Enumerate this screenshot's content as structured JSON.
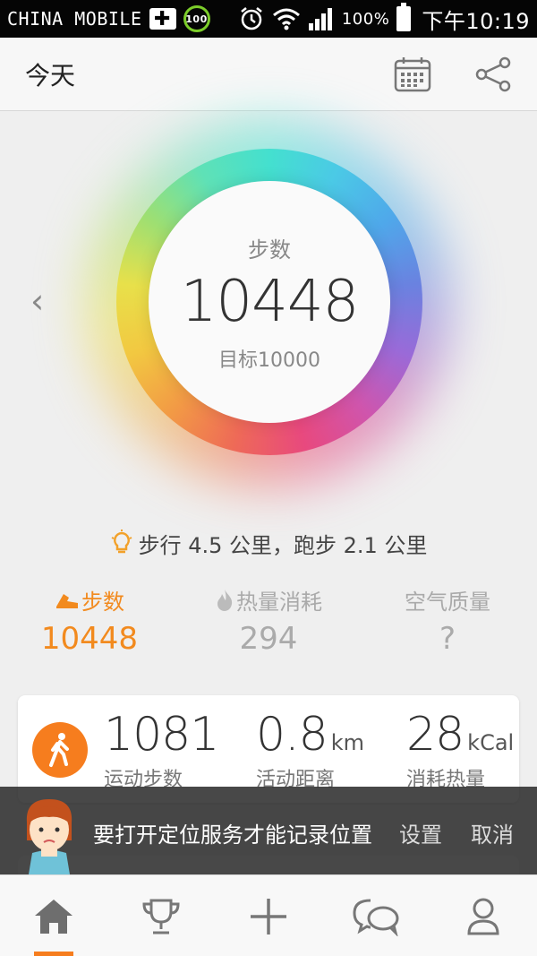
{
  "status_bar": {
    "carrier": "CHINA MOBILE",
    "badge": "100",
    "battery": "100%",
    "time": "下午10:19"
  },
  "header": {
    "title": "今天",
    "icons": [
      "calendar-icon",
      "share-icon"
    ]
  },
  "ring": {
    "label": "步数",
    "steps": "10448",
    "goal": "目标10000",
    "progress": 1.0
  },
  "tip": {
    "text": "步行 4.5 公里，跑步 2.1 公里"
  },
  "stat_tabs": [
    {
      "label": "步数",
      "value": "10448",
      "icon": "shoe-icon",
      "active": true
    },
    {
      "label": "热量消耗",
      "value": "294",
      "icon": "flame-icon",
      "active": false
    },
    {
      "label": "空气质量",
      "value": "?",
      "icon": "",
      "active": false
    }
  ],
  "activity_card": {
    "steps": {
      "value": "1081",
      "unit": "",
      "caption": "运动步数"
    },
    "distance": {
      "value": "0.8",
      "unit": "km",
      "caption": "活动距离"
    },
    "calories": {
      "value": "28",
      "unit": "kCal",
      "caption": "消耗热量"
    }
  },
  "toast": {
    "message": "要打开定位服务才能记录位置",
    "settings": "设置",
    "cancel": "取消"
  },
  "bottom_nav": [
    {
      "name": "home",
      "icon": "home-icon",
      "active": true
    },
    {
      "name": "trophy",
      "icon": "trophy-icon",
      "active": false
    },
    {
      "name": "add",
      "icon": "plus-icon",
      "active": false
    },
    {
      "name": "chat",
      "icon": "chat-icon",
      "active": false
    },
    {
      "name": "profile",
      "icon": "person-icon",
      "active": false
    }
  ],
  "colors": {
    "accent": "#f67d1e",
    "toast_bg": "#282828"
  }
}
